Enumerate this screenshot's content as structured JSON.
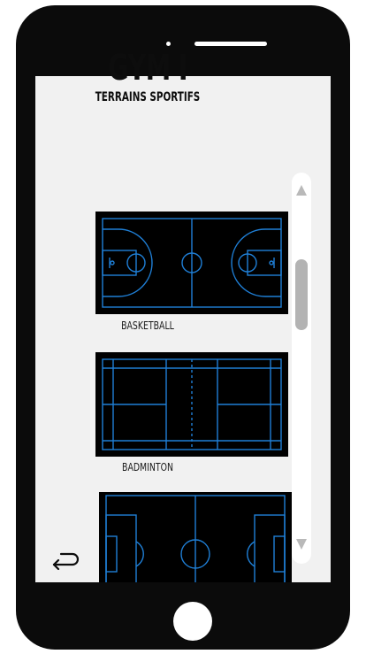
{
  "page": {
    "title": "GYM I",
    "subtitle": "TERRAINS SPORTIFS"
  },
  "courts": [
    {
      "label": "BASKETBALL",
      "icon": "basketball-court-icon"
    },
    {
      "label": "BADMINTON",
      "icon": "badminton-court-icon"
    },
    {
      "label": "",
      "icon": "soccer-field-icon"
    }
  ],
  "colors": {
    "phone": "#0b0b0b",
    "screen": "#f1f1f1",
    "court_bg": "#000000",
    "court_lines": "#1f7fd6",
    "text": "#0d0d0d",
    "scroll_thumb": "#b3b3b3"
  }
}
